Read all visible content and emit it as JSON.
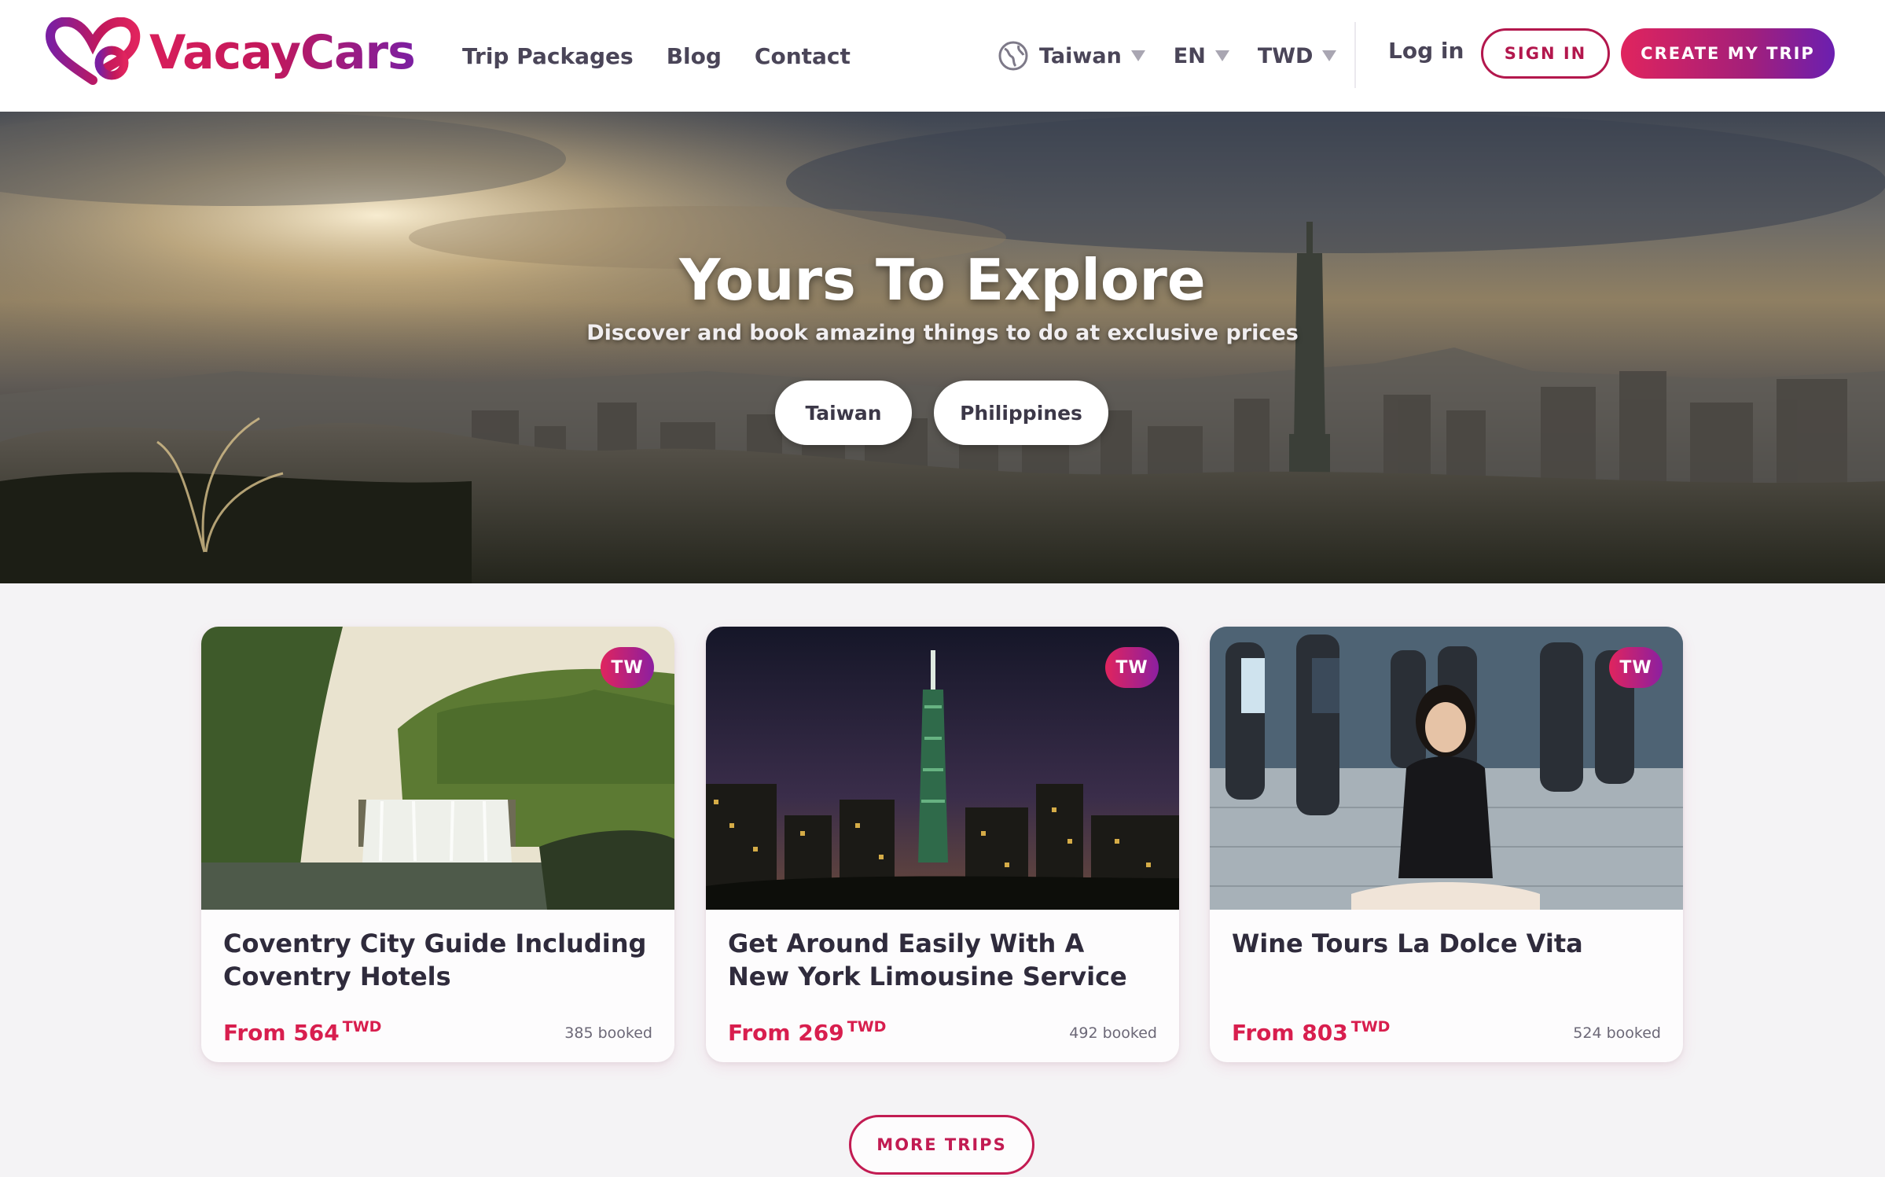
{
  "brand": {
    "name": "VacayCars"
  },
  "nav": {
    "items": [
      "Trip Packages",
      "Blog",
      "Contact"
    ]
  },
  "selectors": {
    "country": "Taiwan",
    "language": "EN",
    "currency": "TWD"
  },
  "auth": {
    "login": "Log in",
    "signin": "SIGN IN",
    "create": "CREATE MY TRIP"
  },
  "hero": {
    "title": "Yours To Explore",
    "subtitle": "Discover and book amazing things to do at exclusive prices",
    "buttons": [
      "Taiwan",
      "Philippines"
    ]
  },
  "cards": [
    {
      "badge": "TW",
      "title": "Coventry City Guide Including Coventry Hotels",
      "price_prefix": "From 564",
      "currency": "TWD",
      "booked": "385 booked",
      "image": "waterfall-photo"
    },
    {
      "badge": "TW",
      "title": "Get Around Easily With A New York Limousine Service",
      "price_prefix": "From 269",
      "currency": "TWD",
      "booked": "492 booked",
      "image": "taipei-night-photo"
    },
    {
      "badge": "TW",
      "title": "Wine Tours La Dolce Vita",
      "price_prefix": "From 803",
      "currency": "TWD",
      "booked": "524 booked",
      "image": "woman-street-photo"
    }
  ],
  "more": {
    "label": "MORE TRIPS"
  },
  "colors": {
    "brand_pink": "#d81e5b",
    "brand_purple": "#7b1fa2",
    "price_red": "#d81e4e"
  },
  "icons": {
    "logo": "heart-logo-icon",
    "globe": "globe-icon",
    "caret": "caret-down-icon"
  }
}
